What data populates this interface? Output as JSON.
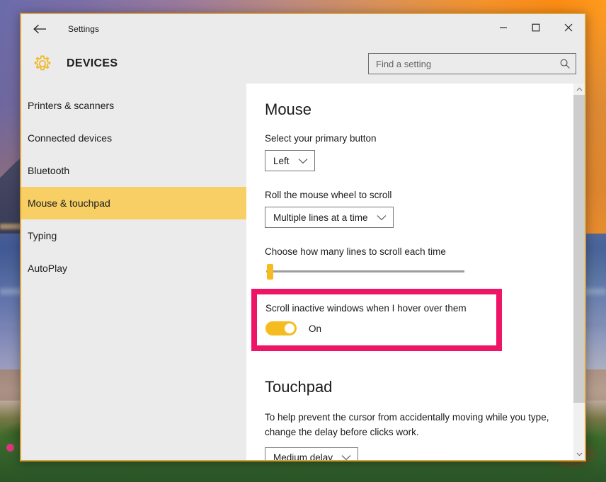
{
  "window": {
    "app_title": "Settings",
    "page_heading": "DEVICES",
    "back_icon": "back-arrow-icon",
    "gear_icon": "gear-icon",
    "minimize_label": "–",
    "maximize_label": "□",
    "close_label": "✕",
    "accent_border": "#d9a13b"
  },
  "search": {
    "placeholder": "Find a setting",
    "value": "",
    "icon": "search-icon"
  },
  "sidebar": {
    "items": [
      {
        "label": "Printers & scanners",
        "active": false
      },
      {
        "label": "Connected devices",
        "active": false
      },
      {
        "label": "Bluetooth",
        "active": false
      },
      {
        "label": "Mouse & touchpad",
        "active": true
      },
      {
        "label": "Typing",
        "active": false
      },
      {
        "label": "AutoPlay",
        "active": false
      }
    ],
    "active_color": "#f7cf64"
  },
  "main": {
    "mouse": {
      "title": "Mouse",
      "primary_button_label": "Select your primary button",
      "primary_button_value": "Left",
      "wheel_label": "Roll the mouse wheel to scroll",
      "wheel_value": "Multiple lines at a time",
      "lines_label": "Choose how many lines to scroll each time",
      "slider_value": "0",
      "inactive_scroll_label": "Scroll inactive windows when I hover over them",
      "inactive_scroll_state": "On"
    },
    "touchpad": {
      "title": "Touchpad",
      "description": "To help prevent the cursor from accidentally moving while you type, change the delay before clicks work.",
      "delay_value": "Medium delay"
    },
    "highlight_color": "#ee1566"
  },
  "scrollbar": {
    "up_arrow": "⌃",
    "down_arrow": "⌄"
  }
}
